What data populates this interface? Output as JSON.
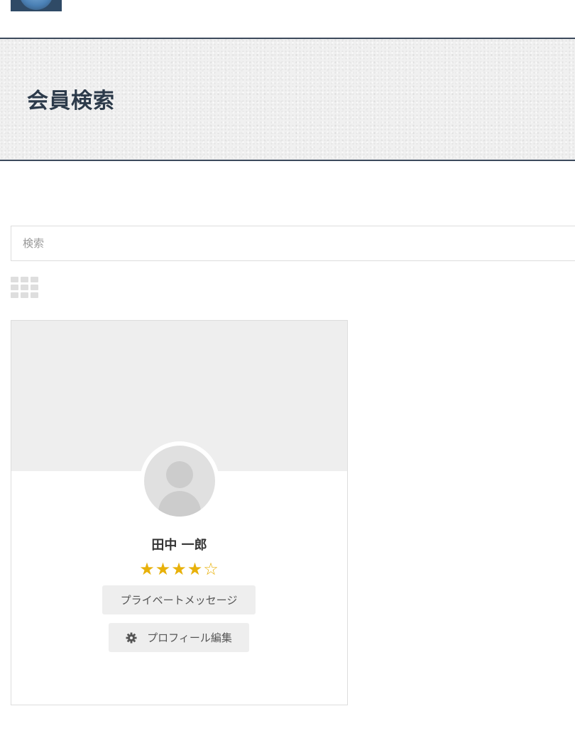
{
  "header": {
    "page_title": "会員検索"
  },
  "search": {
    "placeholder": "検索"
  },
  "view_toggle": {
    "icon": "grid-icon"
  },
  "members": [
    {
      "name": "田中 一郎",
      "rating": 4,
      "rating_max": 5,
      "avatar_icon": "user-silhouette-icon",
      "message_button_label": "プライベートメッセージ",
      "edit_profile_button_label": "プロフィール編集",
      "edit_icon": "gear-icon"
    }
  ],
  "colors": {
    "banner_title": "#2c3a4a",
    "star": "#e8b10a",
    "button_bg": "#eeeeee",
    "cover_bg": "#eeeeee"
  }
}
